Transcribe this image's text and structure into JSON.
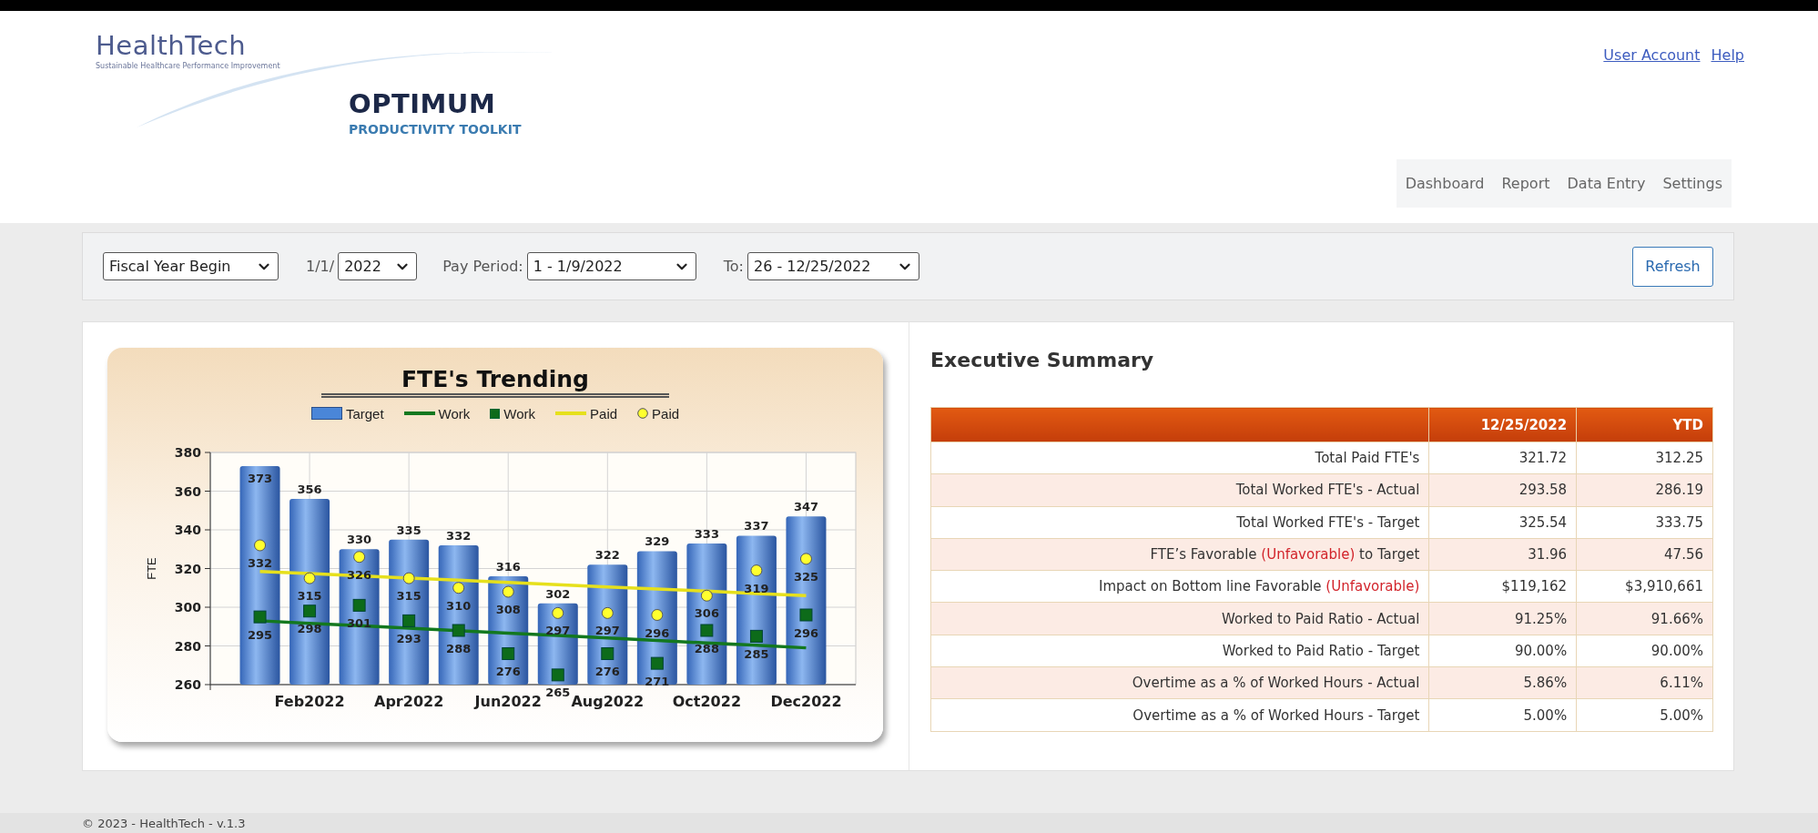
{
  "header": {
    "brand": "HealthTech",
    "tagline": "Sustainable Healthcare Performance Improvement",
    "product": "OPTIMUM",
    "product_subtitle": "PRODUCTIVITY TOOLKIT",
    "links": [
      "User Account",
      "Help"
    ],
    "nav": [
      {
        "label": "Dashboard",
        "selected": false
      },
      {
        "label": "Report",
        "selected": false
      },
      {
        "label": "Data Entry",
        "selected": false
      },
      {
        "label": "Settings",
        "selected": false
      }
    ]
  },
  "filters": {
    "fiscal_year": "Fiscal Year Begin",
    "date_prefix": "1/1/",
    "year": "2022",
    "pay_period_label": "Pay Period:",
    "pay_period": "1 - 1/9/2022",
    "to_label": "To:",
    "to_period": "26 - 12/25/2022",
    "refresh": "Refresh"
  },
  "chart": {
    "chart_data": {
      "type": "bar",
      "title": "FTE's Trending",
      "ylabel": "FTE",
      "categories": [
        null,
        "Feb2022",
        null,
        "Apr2022",
        null,
        "Jun2022",
        null,
        "Aug2022",
        null,
        "Oct2022",
        null,
        "Dec2022"
      ],
      "ylim": [
        260,
        380
      ],
      "yticks": [
        260,
        280,
        300,
        320,
        340,
        360,
        380
      ],
      "grid": true,
      "legend": "top",
      "series": [
        {
          "name": "Target",
          "type": "bar",
          "color": "#4a86d8",
          "values": [
            373,
            356,
            330,
            335,
            332,
            316,
            302,
            322,
            329,
            333,
            337,
            347
          ],
          "value_labels": [
            "373",
            "356",
            "330",
            "335",
            "332",
            "316",
            "302",
            "322",
            "329",
            "333",
            "337",
            "347"
          ]
        },
        {
          "name": "Work",
          "type": "line",
          "color": "#13781f",
          "values": [
            293,
            291.7,
            290.5,
            289.2,
            287.9,
            286.6,
            285.4,
            284.1,
            282.8,
            281.5,
            280.3,
            279
          ]
        },
        {
          "name": "Work",
          "type": "scatter",
          "marker": "square",
          "color": "#0d6b1a",
          "values": [
            295,
            298,
            301,
            293,
            288,
            276,
            265,
            276,
            271,
            288,
            285,
            296
          ],
          "value_labels": [
            "295",
            "298",
            "301",
            "293",
            "288",
            "276",
            "265",
            "276",
            "271",
            "288",
            "285",
            "296"
          ]
        },
        {
          "name": "Paid",
          "type": "line",
          "color": "#e6e01c",
          "values": [
            318.5,
            317.4,
            316.2,
            315.1,
            314,
            312.8,
            311.7,
            310.5,
            309.4,
            308.3,
            307.1,
            306
          ]
        },
        {
          "name": "Paid",
          "type": "scatter",
          "marker": "circle",
          "color": "#ffff2e",
          "values": [
            332,
            315,
            326,
            315,
            310,
            308,
            297,
            297,
            296,
            306,
            319,
            325
          ],
          "value_labels": [
            "332",
            "315",
            "326",
            "315",
            "310",
            "308",
            "297",
            "297",
            "296",
            "306",
            "319",
            "325"
          ]
        }
      ]
    }
  },
  "summary": {
    "title": "Executive Summary",
    "columns": [
      "12/25/2022",
      "YTD"
    ],
    "rows": [
      {
        "parts": [
          {
            "kind": "plain",
            "text": "Total Paid FTE's"
          }
        ],
        "values": [
          "321.72",
          "312.25"
        ]
      },
      {
        "parts": [
          {
            "kind": "plain",
            "text": "Total Worked FTE's - Actual"
          }
        ],
        "values": [
          "293.58",
          "286.19"
        ]
      },
      {
        "parts": [
          {
            "kind": "plain",
            "text": "Total Worked FTE's - Target"
          }
        ],
        "values": [
          "325.54",
          "333.75"
        ]
      },
      {
        "parts": [
          {
            "kind": "plain",
            "text": "FTE’s Favorable "
          },
          {
            "kind": "negative",
            "text": "(Unfavorable)"
          },
          {
            "kind": "plain",
            "text": " to Target"
          }
        ],
        "values": [
          "31.96",
          "47.56"
        ]
      },
      {
        "parts": [
          {
            "kind": "plain",
            "text": "Impact on Bottom line Favorable "
          },
          {
            "kind": "negative",
            "text": "(Unfavorable)"
          }
        ],
        "values": [
          "$119,162",
          "$3,910,661"
        ]
      },
      {
        "parts": [
          {
            "kind": "plain",
            "text": "Worked to Paid Ratio - Actual"
          }
        ],
        "values": [
          "91.25%",
          "91.66%"
        ]
      },
      {
        "parts": [
          {
            "kind": "plain",
            "text": "Worked to Paid Ratio - Target"
          }
        ],
        "values": [
          "90.00%",
          "90.00%"
        ]
      },
      {
        "parts": [
          {
            "kind": "plain",
            "text": "Overtime as a % of Worked Hours - Actual"
          }
        ],
        "values": [
          "5.86%",
          "6.11%"
        ]
      },
      {
        "parts": [
          {
            "kind": "plain",
            "text": "Overtime as a % of Worked Hours - Target"
          }
        ],
        "values": [
          "5.00%",
          "5.00%"
        ]
      }
    ]
  },
  "footer": "© 2023 - HealthTech - v.1.3"
}
